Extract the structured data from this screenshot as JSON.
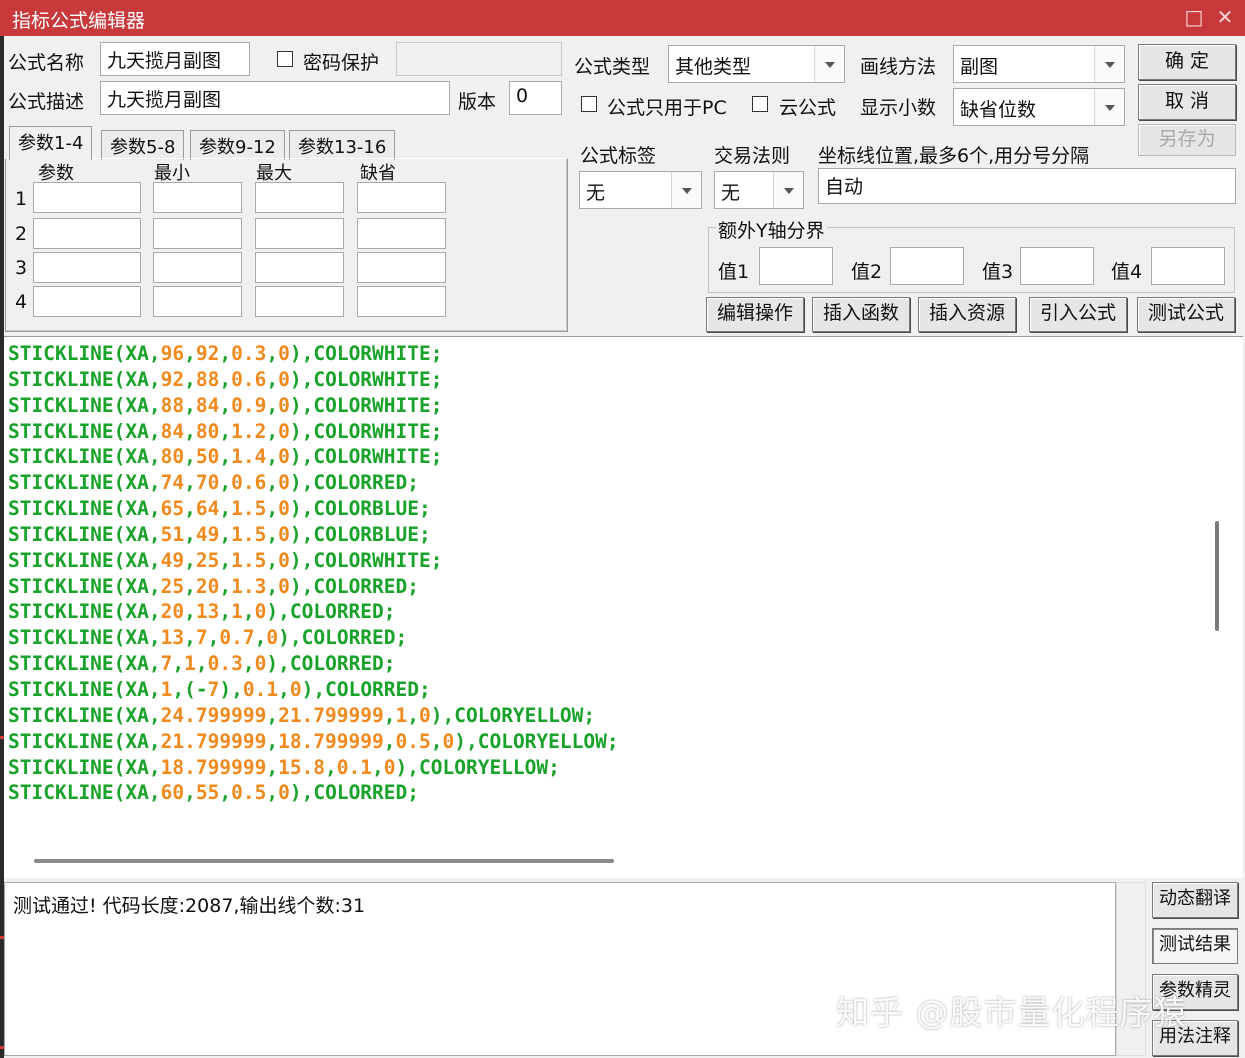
{
  "window": {
    "title": "指标公式编辑器",
    "maximize_glyph": "□",
    "close_glyph": "✕"
  },
  "form": {
    "name_label": "公式名称",
    "name_value": "九天揽月副图",
    "password_label": "密码保护",
    "password_checked": false,
    "password_value": "",
    "desc_label": "公式描述",
    "desc_value": "九天揽月副图",
    "version_label": "版本",
    "version_value": "0",
    "type_label": "公式类型",
    "type_value": "其他类型",
    "draw_label": "画线方法",
    "draw_value": "副图",
    "pc_only_label": "公式只用于PC",
    "pc_only_checked": false,
    "cloud_label": "云公式",
    "cloud_checked": false,
    "decimals_label": "显示小数",
    "decimals_value": "缺省位数",
    "tag_label": "公式标签",
    "tag_value": "无",
    "trade_label": "交易法则",
    "trade_value": "无",
    "coord_label": "坐标线位置,最多6个,用分号分隔",
    "coord_value": "自动"
  },
  "buttons": {
    "ok": "确  定",
    "cancel": "取  消",
    "save_as": "另存为",
    "save_as_enabled": false
  },
  "tabs": [
    {
      "label": "参数1-4",
      "active": true
    },
    {
      "label": "参数5-8",
      "active": false
    },
    {
      "label": "参数9-12",
      "active": false
    },
    {
      "label": "参数13-16",
      "active": false
    }
  ],
  "params": {
    "headers": {
      "param": "参数",
      "min": "最小",
      "max": "最大",
      "default": "缺省"
    },
    "rows": [
      {
        "index": "1",
        "param": "",
        "min": "",
        "max": "",
        "default": ""
      },
      {
        "index": "2",
        "param": "",
        "min": "",
        "max": "",
        "default": ""
      },
      {
        "index": "3",
        "param": "",
        "min": "",
        "max": "",
        "default": ""
      },
      {
        "index": "4",
        "param": "",
        "min": "",
        "max": "",
        "default": ""
      }
    ]
  },
  "y_axis": {
    "group_label": "额外Y轴分界",
    "value_labels": [
      "值1",
      "值2",
      "值3",
      "值4"
    ],
    "values": [
      "",
      "",
      "",
      ""
    ]
  },
  "toolbar": [
    "编辑操作",
    "插入函数",
    "插入资源",
    "引入公式",
    "测试公式"
  ],
  "code_lines": [
    "STICKLINE(XA,96,92,0.3,0),COLORWHITE;",
    "STICKLINE(XA,92,88,0.6,0),COLORWHITE;",
    "STICKLINE(XA,88,84,0.9,0),COLORWHITE;",
    "STICKLINE(XA,84,80,1.2,0),COLORWHITE;",
    "STICKLINE(XA,80,50,1.4,0),COLORWHITE;",
    "STICKLINE(XA,74,70,0.6,0),COLORRED;",
    "STICKLINE(XA,65,64,1.5,0),COLORBLUE;",
    "STICKLINE(XA,51,49,1.5,0),COLORBLUE;",
    "STICKLINE(XA,49,25,1.5,0),COLORWHITE;",
    "STICKLINE(XA,25,20,1.3,0),COLORRED;",
    "STICKLINE(XA,20,13,1,0),COLORRED;",
    "STICKLINE(XA,13,7,0.7,0),COLORRED;",
    "STICKLINE(XA,7,1,0.3,0),COLORRED;",
    "STICKLINE(XA,1,(-7),0.1,0),COLORRED;",
    "STICKLINE(XA,24.799999,21.799999,1,0),COLORYELLOW;",
    "STICKLINE(XA,21.799999,18.799999,0.5,0),COLORYELLOW;",
    "STICKLINE(XA,18.799999,15.8,0.1,0),COLORYELLOW;",
    "STICKLINE(XA,60,55,0.5,0),COLORRED;"
  ],
  "output": {
    "message": "测试通过! 代码长度:2087,输出线个数:31"
  },
  "side_buttons": [
    "动态翻译",
    "测试结果",
    "参数精灵",
    "用法注释"
  ],
  "watermark": "知乎 @股市量化程序猿",
  "colors": {
    "titlebar": "#c8393b",
    "keyword": "#1aa32a",
    "number": "#f08a1e",
    "background": "#f0f0f0"
  }
}
